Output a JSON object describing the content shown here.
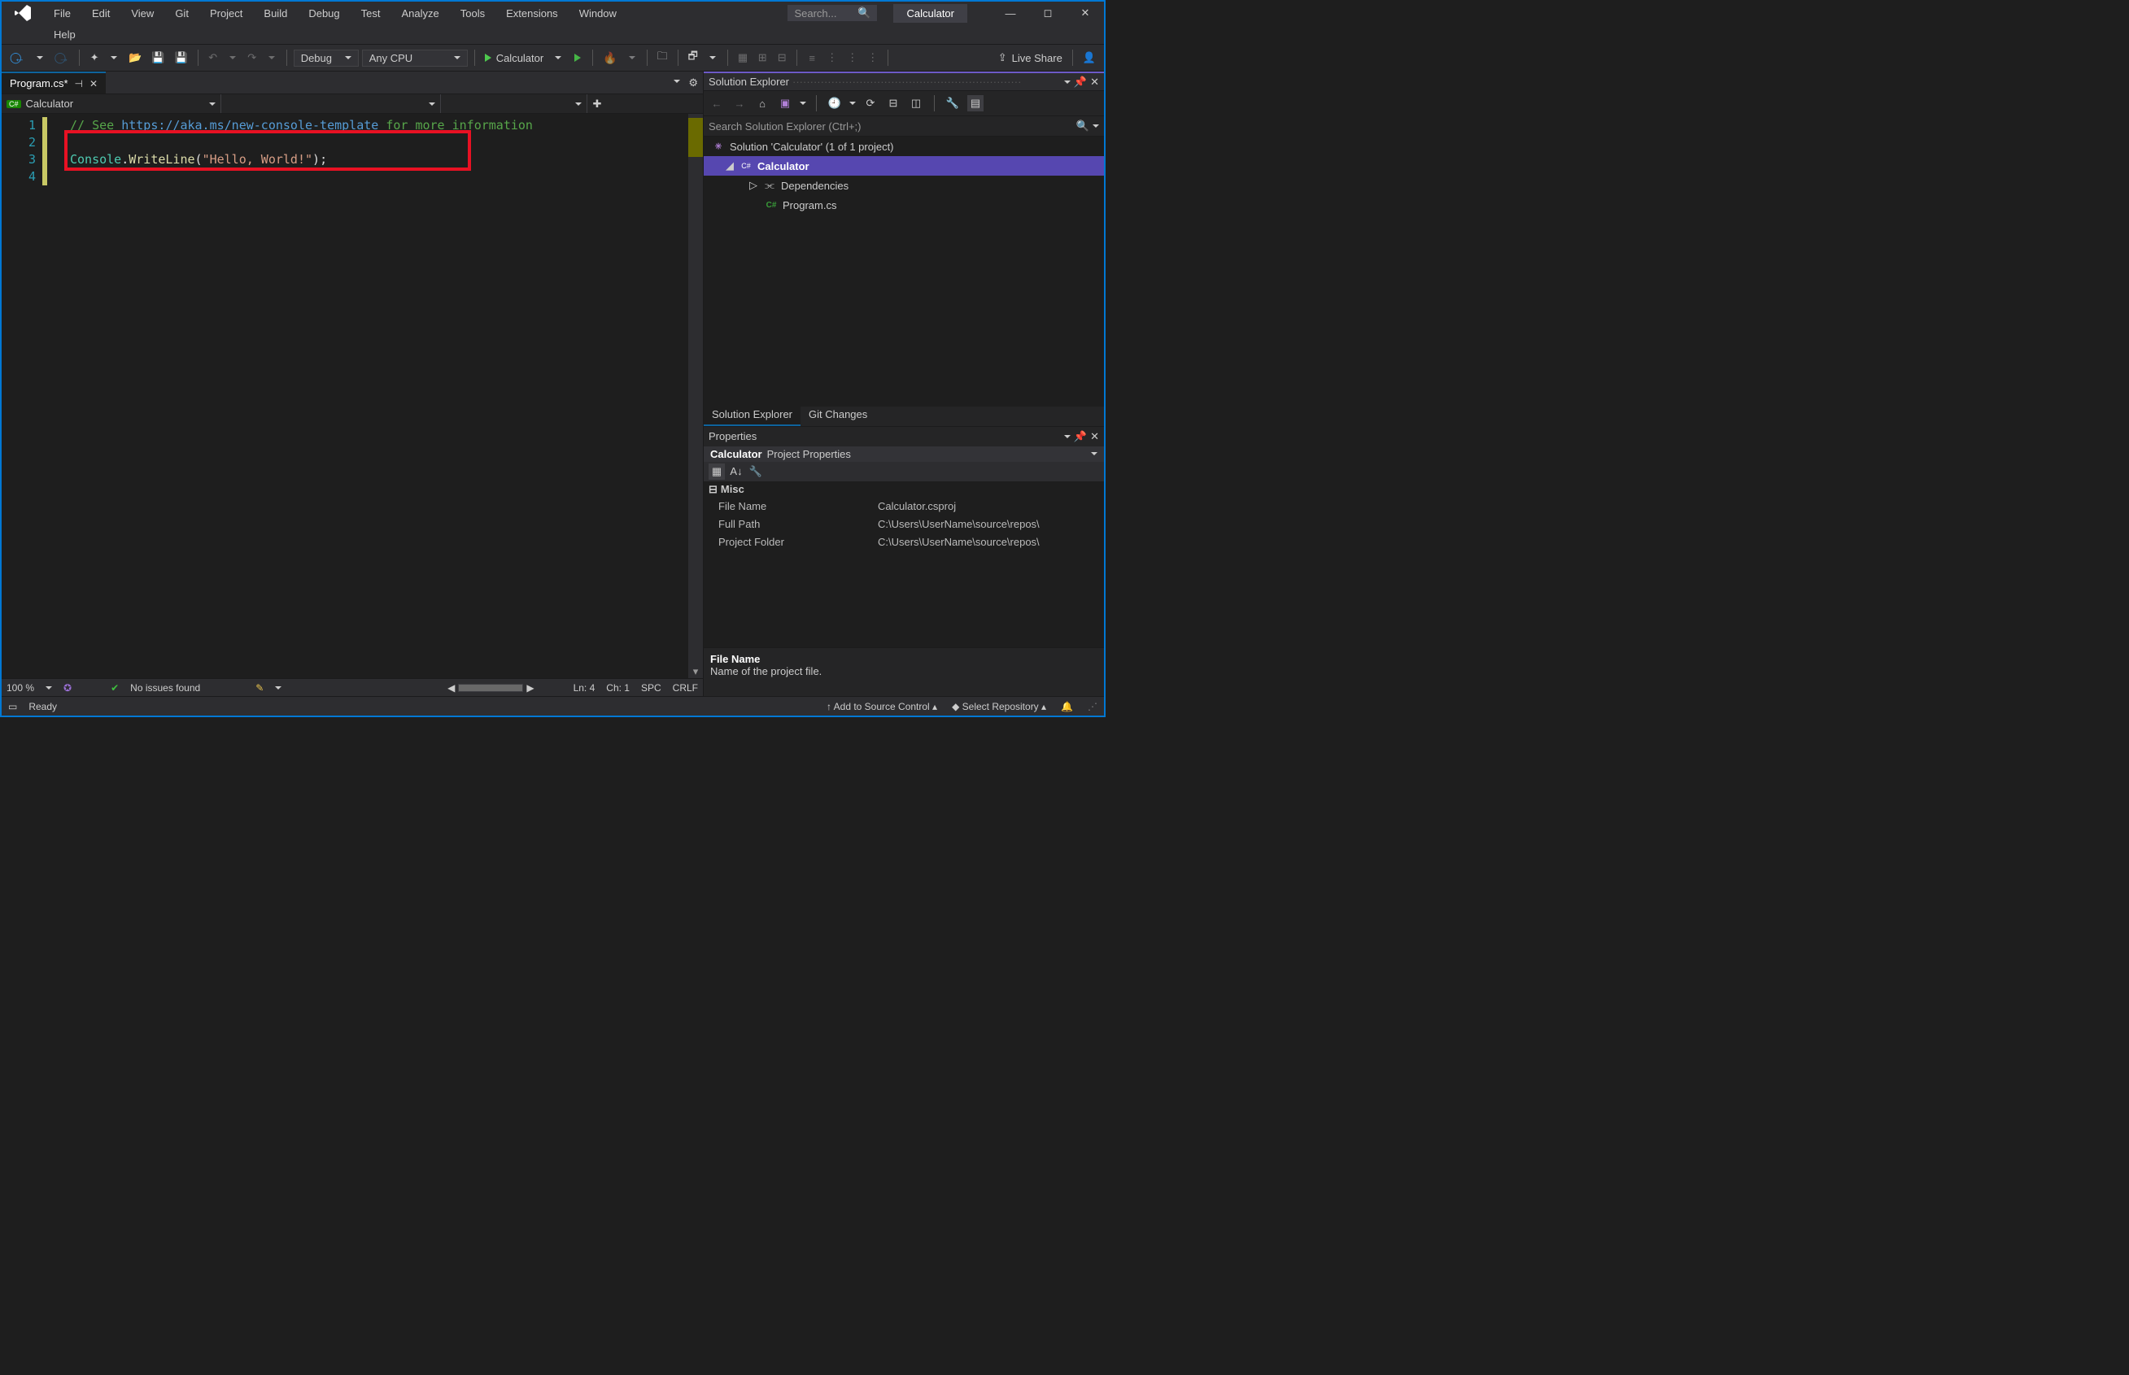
{
  "title": {
    "app": "Calculator"
  },
  "menu": {
    "row1": [
      "File",
      "Edit",
      "View",
      "Git",
      "Project",
      "Build",
      "Debug",
      "Test",
      "Analyze",
      "Tools",
      "Extensions",
      "Window"
    ],
    "row2": [
      "Help"
    ]
  },
  "search_placeholder": "Search...",
  "toolbar": {
    "config": "Debug",
    "platform": "Any CPU",
    "start_target": "Calculator",
    "live_share": "Live Share"
  },
  "doc_tab": {
    "name": "Program.cs*"
  },
  "navbar": {
    "project": "Calculator"
  },
  "code": {
    "comment_prefix": "// See ",
    "comment_link": "https://aka.ms/new-console-template",
    "comment_suffix": " for more information",
    "type": "Console",
    "dot": ".",
    "method": "WriteLine",
    "paren_open": "(",
    "string": "\"Hello, World!\"",
    "paren_close": ")",
    "semi": ";"
  },
  "editor_footer": {
    "zoom": "100 %",
    "no_issues": "No issues found",
    "ln": "Ln: 4",
    "ch": "Ch: 1",
    "ws": "SPC",
    "eol": "CRLF"
  },
  "solution_explorer": {
    "title": "Solution Explorer",
    "search_placeholder": "Search Solution Explorer (Ctrl+;)",
    "solution": "Solution 'Calculator' (1 of 1 project)",
    "project": "Calculator",
    "dependencies": "Dependencies",
    "file": "Program.cs",
    "tab_active": "Solution Explorer",
    "tab_other": "Git Changes"
  },
  "properties": {
    "title": "Properties",
    "subject_name": "Calculator",
    "subject_kind": "Project Properties",
    "category": "Misc",
    "rows": [
      {
        "k": "File Name",
        "v": "Calculator.csproj"
      },
      {
        "k": "Full Path",
        "v": "C:\\Users\\UserName\\source\\repos\\"
      },
      {
        "k": "Project Folder",
        "v": "C:\\Users\\UserName\\source\\repos\\"
      }
    ],
    "desc_title": "File Name",
    "desc_body": "Name of the project file."
  },
  "statusbar": {
    "ready": "Ready",
    "add_src": "Add to Source Control",
    "select_repo": "Select Repository"
  }
}
